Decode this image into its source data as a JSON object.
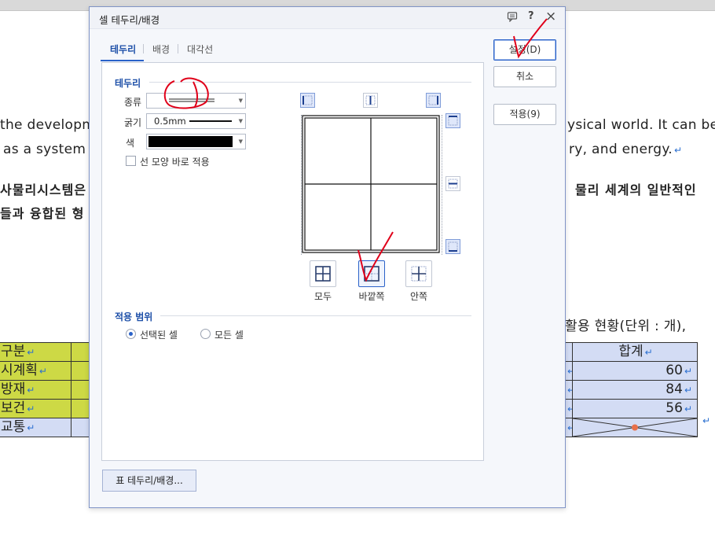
{
  "document": {
    "line1_left": "the developm",
    "line1_right": "ysical world. It can be",
    "line2_left": "as a system",
    "line2_right": "ry, and energy.",
    "line3_left": "사물리시스템은",
    "line3_right": "물리 세계의 일반적인",
    "line4_left": "들과 융합된 형",
    "caption_right": "활용 현황(단위 : 개),",
    "table_left": [
      "구분",
      "시계획",
      "방재",
      "보건",
      "교통"
    ],
    "table_right_header": "합계",
    "table_right_values": [
      "60",
      "84",
      "56"
    ],
    "return_mark": "↵"
  },
  "dialog": {
    "title": "셀 테두리/배경",
    "title_icons": [
      "comment-icon",
      "help-icon",
      "close-icon"
    ],
    "help_glyph": "?",
    "close_glyph": "×",
    "tabs": [
      "테두리",
      "배경",
      "대각선"
    ],
    "active_tab": "테두리",
    "border_section": {
      "title": "테두리",
      "type_label": "종류",
      "thickness_label": "굵기",
      "thickness_value": "0.5mm",
      "color_label": "색",
      "color_value": "#000000",
      "apply_line_checkbox": "선 모양 바로 적용",
      "apply_line_checked": false
    },
    "presets": [
      {
        "label": "모두",
        "selected": false
      },
      {
        "label": "바깥쪽",
        "selected": true
      },
      {
        "label": "안쪽",
        "selected": false
      }
    ],
    "scope_section": {
      "title": "적용 범위",
      "options": [
        "선택된 셀",
        "모든 셀"
      ],
      "selected": "선택된 셀"
    },
    "buttons": {
      "ok": "설정(D)",
      "cancel": "취소",
      "apply": "적용(9)",
      "table_border": "표 테두리/배경..."
    }
  },
  "colors": {
    "accent": "#2a62c9",
    "annotation_red": "#e0001a",
    "table_green": "#cdd945",
    "table_blue": "#d3dcf4"
  }
}
